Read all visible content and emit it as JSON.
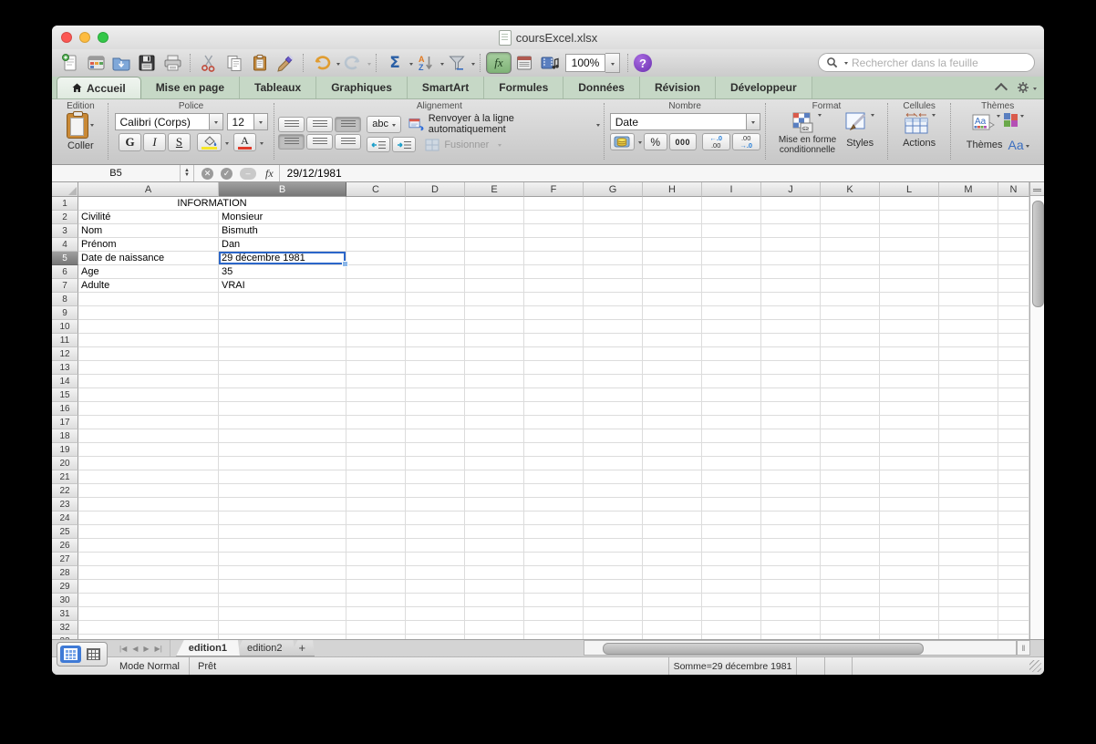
{
  "window": {
    "title": "coursExcel.xlsx"
  },
  "toolbar": {
    "zoom": "100%",
    "search_placeholder": "Rechercher dans la feuille"
  },
  "tabs": [
    {
      "label": "Accueil",
      "active": true
    },
    {
      "label": "Mise en page"
    },
    {
      "label": "Tableaux"
    },
    {
      "label": "Graphiques"
    },
    {
      "label": "SmartArt"
    },
    {
      "label": "Formules"
    },
    {
      "label": "Données"
    },
    {
      "label": "Révision"
    },
    {
      "label": "Développeur"
    }
  ],
  "ribbon": {
    "edition": {
      "label": "Edition",
      "paste": "Coller"
    },
    "police": {
      "label": "Police",
      "font": "Calibri (Corps)",
      "size": "12",
      "bold": "G",
      "italic": "I",
      "underline": "S"
    },
    "alignement": {
      "label": "Alignement",
      "abc": "abc",
      "wrap": "Renvoyer à la ligne automatiquement",
      "merge": "Fusionner"
    },
    "nombre": {
      "label": "Nombre",
      "format": "Date",
      "percent": "%",
      "thousands": "000",
      "dec_left": [
        "←.0",
        ".00"
      ],
      "dec_right": [
        ".00",
        "→.0"
      ]
    },
    "format": {
      "label": "Format",
      "conditional_1": "Mise en forme",
      "conditional_2": "conditionnelle",
      "styles": "Styles"
    },
    "cellules": {
      "label": "Cellules",
      "actions": "Actions"
    },
    "themes": {
      "label": "Thèmes",
      "themes": "Thèmes",
      "fonts": "Aa"
    }
  },
  "formula_bar": {
    "cell_ref": "B5",
    "fx": "fx",
    "value": "29/12/1981"
  },
  "grid": {
    "columns": [
      "A",
      "B",
      "C",
      "D",
      "E",
      "F",
      "G",
      "H",
      "I",
      "J",
      "K",
      "L",
      "M",
      "N"
    ],
    "row_count": 33,
    "selected": {
      "col": "B",
      "row": 5
    },
    "merged_title": {
      "row": 1,
      "text": "INFORMATION"
    },
    "cells": [
      {
        "row": 2,
        "A": "Civilité",
        "B": "Monsieur"
      },
      {
        "row": 3,
        "A": "Nom",
        "B": "Bismuth"
      },
      {
        "row": 4,
        "A": "Prénom",
        "B": "Dan"
      },
      {
        "row": 5,
        "A": "Date de naissance",
        "B": "29 décembre 1981"
      },
      {
        "row": 6,
        "A": "Age",
        "B": "35"
      },
      {
        "row": 7,
        "A": "Adulte",
        "B": "VRAI"
      }
    ]
  },
  "sheet_tabs": [
    {
      "label": "edition1",
      "active": true
    },
    {
      "label": "edition2"
    },
    {
      "label": "+",
      "add": true
    }
  ],
  "status": {
    "mode": "Mode Normal",
    "ready": "Prêt",
    "sum": "Somme=29 décembre 1981"
  },
  "colors": {
    "selection_border": "#2b66c9",
    "tab_strip_green": "#bfd3bf",
    "fx_active_green": "#8fbf8f",
    "help_purple": "#6a2fb0",
    "traffic_red": "#fc5753",
    "traffic_yellow": "#fdbc40",
    "traffic_green": "#33c748"
  }
}
